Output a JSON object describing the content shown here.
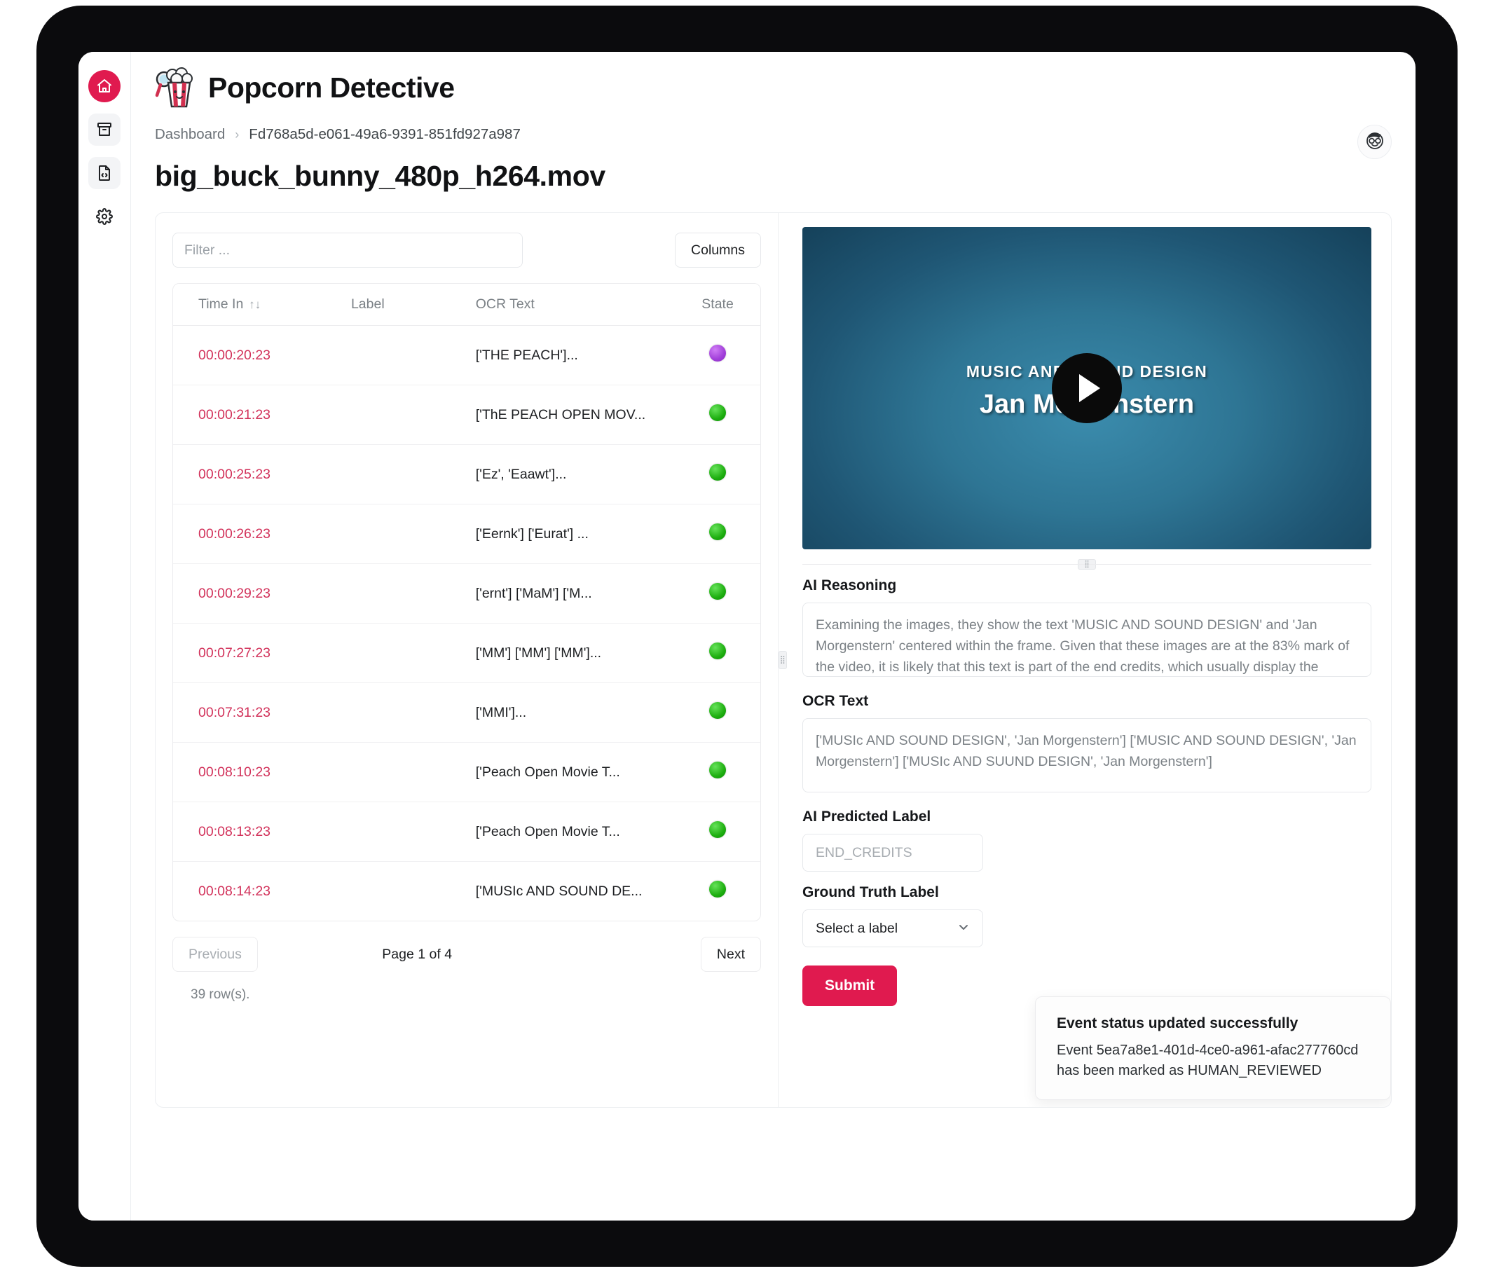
{
  "app": {
    "title": "Popcorn Detective",
    "logo_icon": "popcorn-magnifier-icon"
  },
  "sidebar": {
    "items": [
      {
        "icon": "home-icon",
        "name": "home",
        "active": true
      },
      {
        "icon": "archive-box-icon",
        "name": "archive",
        "active": false
      },
      {
        "icon": "file-code-icon",
        "name": "file-code",
        "active": false
      },
      {
        "icon": "gear-icon",
        "name": "settings",
        "active": false
      }
    ]
  },
  "header": {
    "breadcrumb": {
      "root": "Dashboard",
      "separator": "›",
      "current": "Fd768a5d-e061-49a6-9391-851fd927a987"
    },
    "page_title": "big_buck_bunny_480p_h264.mov",
    "avatar_icon": "user-avatar-icon"
  },
  "toolbar": {
    "filter_placeholder": "Filter ...",
    "filter_value": "",
    "columns_label": "Columns"
  },
  "table": {
    "columns": [
      "Time In",
      "Label",
      "OCR Text",
      "State"
    ],
    "sort_icon": "↑↓",
    "rows": [
      {
        "time_in": "00:00:20:23",
        "label": "",
        "ocr_text": "['THE PEACH']...",
        "state": "purple"
      },
      {
        "time_in": "00:00:21:23",
        "label": "",
        "ocr_text": "['ThE PEACH OPEN MOV...",
        "state": "green"
      },
      {
        "time_in": "00:00:25:23",
        "label": "",
        "ocr_text": "['Ez', 'Eaawt']...",
        "state": "green"
      },
      {
        "time_in": "00:00:26:23",
        "label": "",
        "ocr_text": "['Eernk'] ['Eurat'] ...",
        "state": "green"
      },
      {
        "time_in": "00:00:29:23",
        "label": "",
        "ocr_text": "['ernt'] ['MaM'] ['M...",
        "state": "green"
      },
      {
        "time_in": "00:07:27:23",
        "label": "",
        "ocr_text": "['MM'] ['MM'] ['MM']...",
        "state": "green"
      },
      {
        "time_in": "00:07:31:23",
        "label": "",
        "ocr_text": "['MMI']...",
        "state": "green"
      },
      {
        "time_in": "00:08:10:23",
        "label": "",
        "ocr_text": "['Peach Open Movie T...",
        "state": "green"
      },
      {
        "time_in": "00:08:13:23",
        "label": "",
        "ocr_text": "['Peach Open Movie T...",
        "state": "green"
      },
      {
        "time_in": "00:08:14:23",
        "label": "",
        "ocr_text": "['MUSIc AND SOUND DE...",
        "state": "green"
      }
    ]
  },
  "pagination": {
    "previous_label": "Previous",
    "next_label": "Next",
    "page_info": "Page 1 of 4",
    "row_count": "39 row(s)."
  },
  "video": {
    "overlay_line1": "MUSIC AND SOUND DESIGN",
    "overlay_line2": "Jan Morgenstern",
    "play_icon": "play-icon"
  },
  "details": {
    "ai_reasoning_label": "AI Reasoning",
    "ai_reasoning_value": "Examining the images, they show the text 'MUSIC AND SOUND DESIGN' and 'Jan Morgenstern' centered within the frame. Given that these images are at the 83% mark of the video, it is likely that this text is part of the end credits, which usually display the names of people and their roles in the production.",
    "ocr_text_label": "OCR Text",
    "ocr_text_value": "['MUSIc AND SOUND DESIGN', 'Jan Morgenstern'] ['MUSIC AND SOUND DESIGN', 'Jan Morgenstern'] ['MUSIc AND SUUND DESIGN', 'Jan Morgenstern']",
    "ai_predicted_label_label": "AI Predicted Label",
    "ai_predicted_label_value": "END_CREDITS",
    "ground_truth_label_label": "Ground Truth Label",
    "ground_truth_selected": "Select a label",
    "chevron_icon": "chevron-down-icon",
    "submit_label": "Submit"
  },
  "toast": {
    "title": "Event status updated successfully",
    "message": "Event 5ea7a8e1-401d-4ce0-a961-afac277760cd has been marked as HUMAN_REVIEWED"
  },
  "colors": {
    "accent": "#e01a4f",
    "time_text": "#d2315a",
    "state_green": "#1eae10",
    "state_purple": "#a13fd9"
  }
}
